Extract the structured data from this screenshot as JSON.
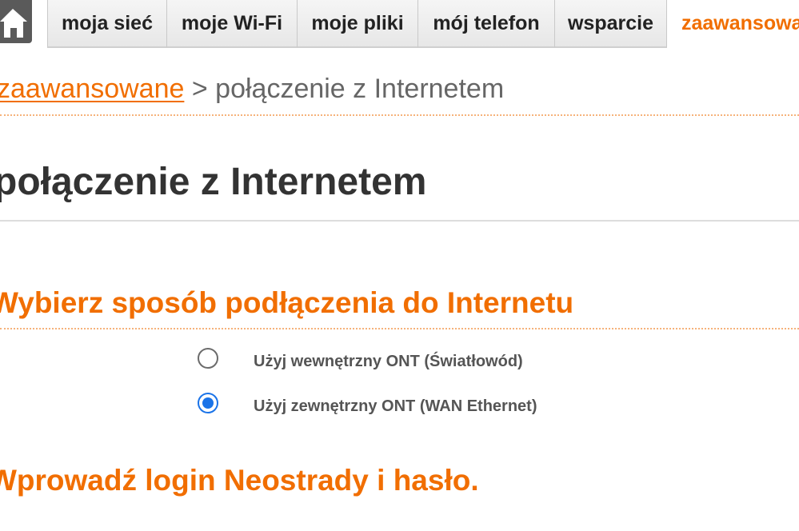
{
  "nav": {
    "home_icon": "home-icon",
    "tabs": [
      {
        "label": "moja sieć"
      },
      {
        "label": "moje Wi-Fi"
      },
      {
        "label": "moje pliki"
      },
      {
        "label": "mój telefon"
      },
      {
        "label": "wsparcie"
      },
      {
        "label": "zaawansowane",
        "active": true
      }
    ]
  },
  "breadcrumb": {
    "link": "zaawansowane",
    "separator": ">",
    "current": "połączenie z Internetem"
  },
  "page_title": "połączenie z Internetem",
  "connection_section": {
    "heading": "Wybierz sposób podłączenia do Internetu",
    "options": [
      {
        "label": "Użyj wewnętrzny ONT (Światłowód)",
        "selected": false
      },
      {
        "label": "Użyj zewnętrzny ONT (WAN Ethernet)",
        "selected": true
      }
    ]
  },
  "login_section": {
    "heading": "Wprowadź login Neostrady i hasło."
  },
  "colors": {
    "accent": "#f16e00",
    "radio_selected": "#1a73e8",
    "text_dark": "#333333",
    "text_muted": "#666666"
  }
}
